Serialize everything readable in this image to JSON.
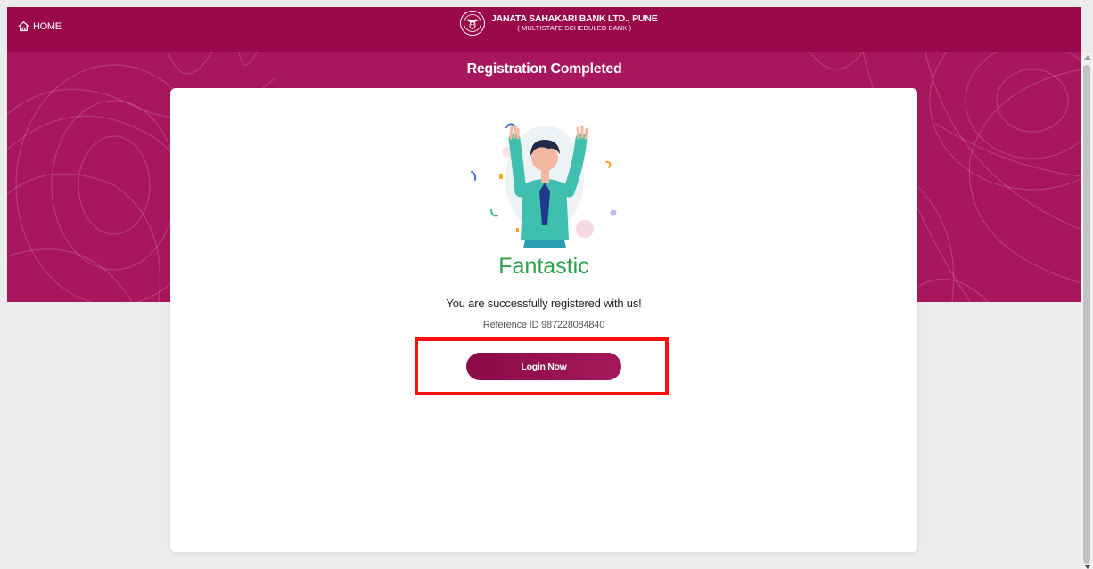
{
  "header": {
    "home_label": "HOME",
    "bank_name": "JANATA SAHAKARI BANK LTD., PUNE",
    "bank_subtitle": "( MULTISTATE SCHEDULED BANK )"
  },
  "page": {
    "title": "Registration Completed"
  },
  "result": {
    "heading": "Fantastic",
    "message": "You are successfully registered with us!",
    "reference_label": "Reference ID 987228084840",
    "login_button_label": "Login Now"
  },
  "colors": {
    "brand": "#9a0a4b",
    "banner": "#a8175d",
    "success": "#2aa24a",
    "highlight": "#ff1010"
  },
  "icons": {
    "home": "home-icon",
    "logo": "bank-logo",
    "illustration": "celebrating-person-illustration"
  }
}
